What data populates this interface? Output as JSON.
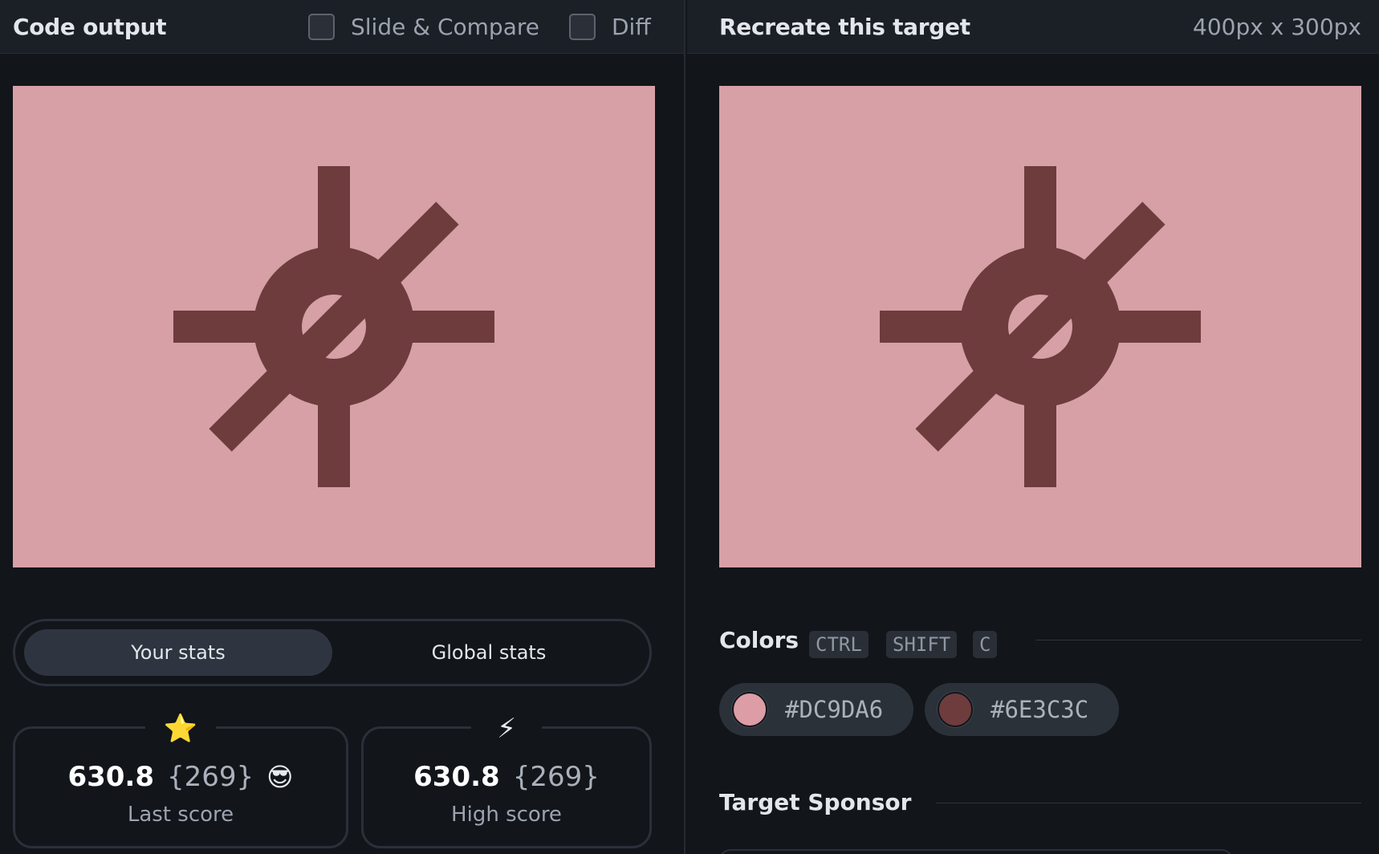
{
  "left_pane": {
    "title": "Code output",
    "options": [
      {
        "label": "Slide & Compare",
        "checked": false
      },
      {
        "label": "Diff",
        "checked": false
      }
    ]
  },
  "right_pane": {
    "title": "Recreate this target",
    "dimensions": "400px x 300px"
  },
  "canvas": {
    "background": "#D6A0A6",
    "foreground": "#6E3C3C"
  },
  "stats_tabs": {
    "active": "Your stats",
    "inactive": "Global stats"
  },
  "last_score": {
    "icon": "star-icon",
    "glyph": "⭐",
    "score": "630.8",
    "rank": "{269}",
    "emoji": "😎",
    "label": "Last score"
  },
  "high_score": {
    "icon": "lightning-icon",
    "glyph": "⚡",
    "score": "630.8",
    "rank": "{269}",
    "label": "High score"
  },
  "colors_section": {
    "title": "Colors",
    "shortcut": [
      "CTRL",
      "SHIFT",
      "C"
    ],
    "swatches": [
      {
        "hex": "#DC9DA6",
        "label": "#DC9DA6"
      },
      {
        "hex": "#6E3C3C",
        "label": "#6E3C3C"
      }
    ]
  },
  "sponsor_section": {
    "title": "Target Sponsor"
  }
}
